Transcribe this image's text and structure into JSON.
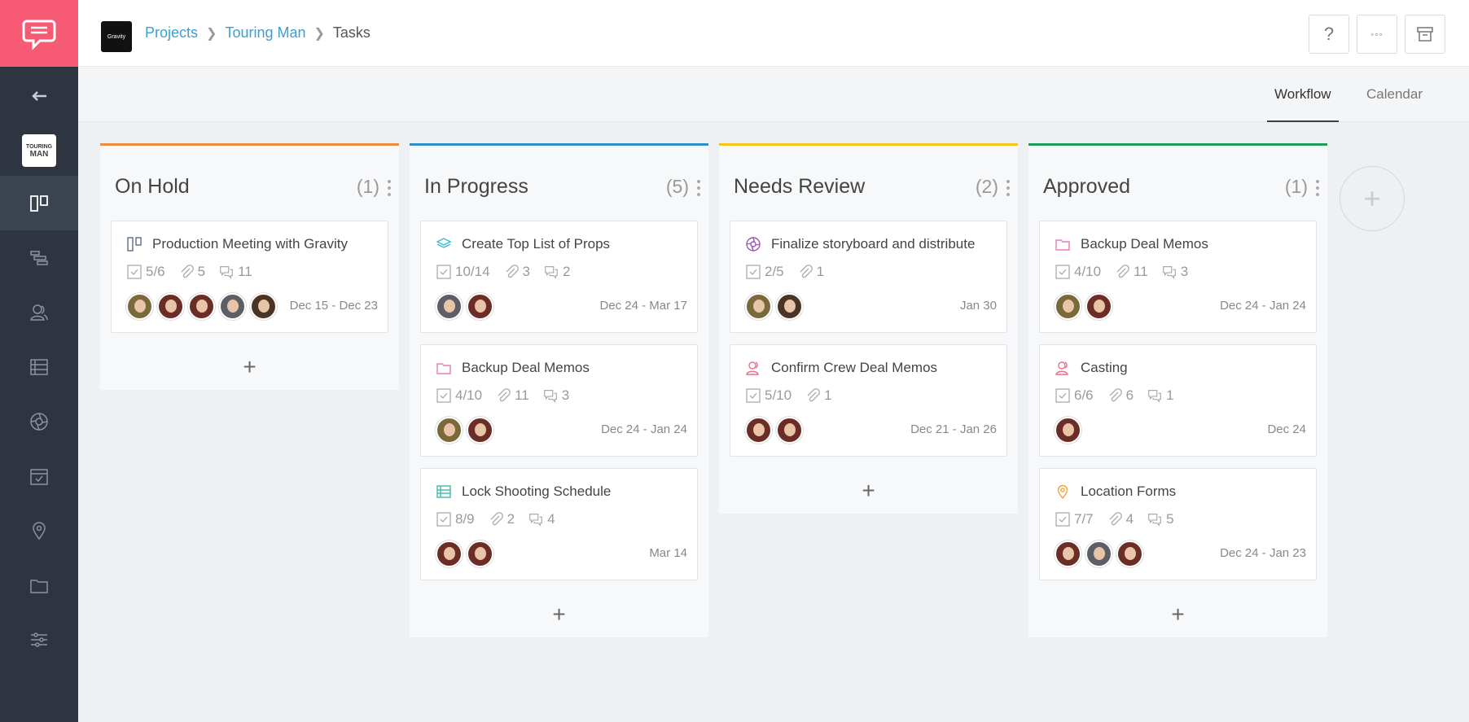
{
  "header": {
    "client_logo": "Gravity",
    "breadcrumb": [
      "Projects",
      "Touring Man",
      "Tasks"
    ],
    "help_label": "?",
    "more_label": "◦◦◦"
  },
  "sidebar": {
    "project_thumb": [
      "TOURING",
      "MAN"
    ],
    "items": [
      "back-arrow-icon",
      "project-thumbnail",
      "board-icon",
      "gantt-icon",
      "people-icon",
      "list-icon",
      "aperture-icon",
      "calendar-icon",
      "location-pin-icon",
      "folder-icon",
      "sliders-icon"
    ]
  },
  "tabs": [
    {
      "label": "Workflow",
      "active": true
    },
    {
      "label": "Calendar",
      "active": false
    }
  ],
  "columns": [
    {
      "title": "On Hold",
      "count": "(1)",
      "color": "#f08a3c",
      "cards": [
        {
          "icon": "board-icon",
          "title": "Production Meeting with Gravity",
          "tasks": "5/6",
          "attachments": "5",
          "comments": "11",
          "avatars": [
            "m1",
            "f",
            "f",
            "m2",
            "m3"
          ],
          "date": "Dec 15 - Dec 23"
        }
      ]
    },
    {
      "title": "In Progress",
      "count": "(5)",
      "color": "#2b8fc3",
      "cards": [
        {
          "icon": "layers-icon",
          "title": "Create Top List of Props",
          "tasks": "10/14",
          "attachments": "3",
          "comments": "2",
          "avatars": [
            "m2",
            "f"
          ],
          "date": "Dec 24 - Mar 17"
        },
        {
          "icon": "folder-icon",
          "title": "Backup Deal Memos",
          "tasks": "4/10",
          "attachments": "11",
          "comments": "3",
          "avatars": [
            "m1",
            "f"
          ],
          "date": "Dec 24 - Jan 24"
        },
        {
          "icon": "list-icon",
          "title": "Lock Shooting Schedule",
          "tasks": "8/9",
          "attachments": "2",
          "comments": "4",
          "avatars": [
            "f",
            "f"
          ],
          "date": "Mar 14"
        }
      ]
    },
    {
      "title": "Needs Review",
      "count": "(2)",
      "color": "#f5c518",
      "cards": [
        {
          "icon": "aperture-icon",
          "title": "Finalize storyboard and distribute",
          "tasks": "2/5",
          "attachments": "1",
          "comments": "",
          "avatars": [
            "m1",
            "m3"
          ],
          "date": "Jan 30"
        },
        {
          "icon": "people-icon",
          "title": "Confirm Crew Deal Memos",
          "tasks": "5/10",
          "attachments": "1",
          "comments": "",
          "avatars": [
            "f",
            "f"
          ],
          "date": "Dec 21 - Jan 26"
        }
      ]
    },
    {
      "title": "Approved",
      "count": "(1)",
      "color": "#1f9a57",
      "cards": [
        {
          "icon": "folder-icon",
          "title": "Backup Deal Memos",
          "tasks": "4/10",
          "attachments": "11",
          "comments": "3",
          "avatars": [
            "m1",
            "f"
          ],
          "date": "Dec 24 - Jan 24"
        },
        {
          "icon": "people-icon",
          "title": "Casting",
          "tasks": "6/6",
          "attachments": "6",
          "comments": "1",
          "avatars": [
            "f"
          ],
          "date": "Dec 24"
        },
        {
          "icon": "location-pin-icon",
          "title": "Location Forms",
          "tasks": "7/7",
          "attachments": "4",
          "comments": "5",
          "avatars": [
            "f",
            "m2",
            "f"
          ],
          "date": "Dec 24 - Jan 23"
        }
      ]
    }
  ],
  "add_label": "+"
}
